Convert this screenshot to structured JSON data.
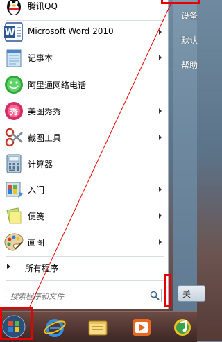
{
  "start_menu": {
    "programs": [
      {
        "label": "腾讯QQ",
        "icon": "qq-penguin-icon",
        "has_submenu": false
      },
      {
        "label": "Microsoft Word 2010",
        "icon": "word-icon",
        "has_submenu": true
      },
      {
        "label": "记事本",
        "icon": "notepad-icon",
        "has_submenu": true
      },
      {
        "label": "阿里通网络电话",
        "icon": "phone-smiley-icon",
        "has_submenu": false
      },
      {
        "label": "美图秀秀",
        "icon": "meitu-icon",
        "has_submenu": true
      },
      {
        "label": "截图工具",
        "icon": "scissors-icon",
        "has_submenu": true
      },
      {
        "label": "计算器",
        "icon": "calculator-icon",
        "has_submenu": false
      },
      {
        "label": "入门",
        "icon": "getting-started-icon",
        "has_submenu": true
      },
      {
        "label": "便笺",
        "icon": "sticky-notes-icon",
        "has_submenu": true
      },
      {
        "label": "画图",
        "icon": "paint-palette-icon",
        "has_submenu": true
      }
    ],
    "all_programs_label": "所有程序",
    "search": {
      "placeholder": "搜索程序和文件"
    },
    "right_items": [
      "设备",
      "默认",
      "帮助"
    ],
    "shutdown_label": "关"
  },
  "taskbar": {
    "icons": [
      "start-orb-icon",
      "ie-icon",
      "explorer-icon",
      "media-player-icon",
      "qq-music-icon"
    ]
  },
  "annotation": {
    "highlight_color": "#e60000"
  }
}
